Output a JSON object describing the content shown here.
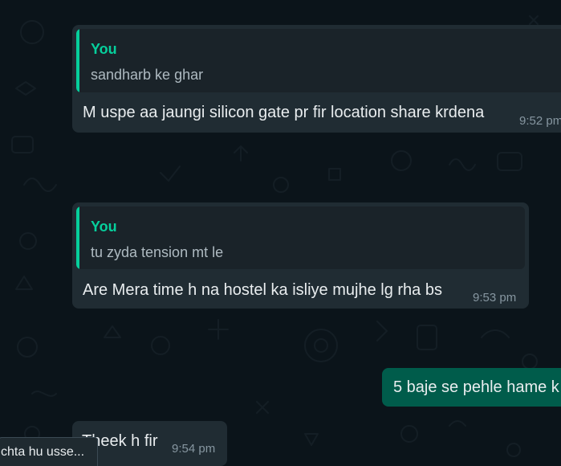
{
  "messages": [
    {
      "direction": "incoming",
      "quote_author": "You",
      "quote_text": "sandharb ke ghar",
      "text": "M uspe aa jaungi silicon gate pr fir location share krdena",
      "time": "9:52 pm"
    },
    {
      "direction": "incoming",
      "quote_author": "You",
      "quote_text": "tu zyda tension mt le",
      "text": "Are Mera time h na hostel ka isliye mujhe lg rha bs",
      "time": "9:53 pm"
    },
    {
      "direction": "outgoing",
      "text": "5 baje se pehle hame k"
    },
    {
      "direction": "incoming",
      "text": "Theek h fir",
      "time": "9:54 pm"
    }
  ],
  "tooltip": {
    "text": "chta hu usse..."
  },
  "colors": {
    "background": "#0b141a",
    "incoming_bubble": "#202c33",
    "outgoing_bubble": "#005c4b",
    "quote_accent": "#06cf9c",
    "timestamp": "#8696a0"
  }
}
